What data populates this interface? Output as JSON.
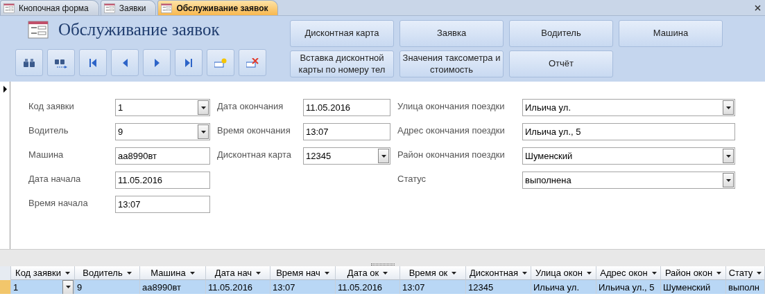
{
  "tabs": [
    {
      "label": "Кнопочная форма",
      "selected": false
    },
    {
      "label": "Заявки",
      "selected": false
    },
    {
      "label": "Обслуживание заявок",
      "selected": true
    }
  ],
  "title": "Обслуживание заявок",
  "nav_buttons": [
    {
      "kind": "find"
    },
    {
      "kind": "find-next"
    },
    {
      "kind": "first"
    },
    {
      "kind": "prev"
    },
    {
      "kind": "next"
    },
    {
      "kind": "last"
    },
    {
      "kind": "new"
    },
    {
      "kind": "delete"
    }
  ],
  "action_buttons": [
    [
      "Дисконтная карта",
      "Заявка",
      "Водитель",
      "Машина"
    ],
    [
      "Вставка дисконтной карты по номеру тел",
      "Значения таксометра и стоимость",
      "Отчёт"
    ]
  ],
  "fields": [
    [
      {
        "label": "Код заявки",
        "value": "1",
        "kind": "combo"
      },
      {
        "label": "Водитель",
        "value": "9",
        "kind": "combo"
      },
      {
        "label": "Машина",
        "value": "аа8990вт",
        "kind": "text"
      },
      {
        "label": "Дата начала",
        "value": "11.05.2016",
        "kind": "text"
      },
      {
        "label": "Время начала",
        "value": "13:07",
        "kind": "text"
      }
    ],
    [
      {
        "label": "Дата окончания",
        "value": "11.05.2016",
        "kind": "text"
      },
      {
        "label": "Время окончания",
        "value": "13:07",
        "kind": "text"
      },
      {
        "label": "Дисконтная карта",
        "value": "12345",
        "kind": "combo"
      }
    ],
    [
      {
        "label": "Улица окончания поездки",
        "value": "Ильича ул.",
        "kind": "combo"
      },
      {
        "label": "Адрес окончания поездки",
        "value": "Ильича ул., 5",
        "kind": "text"
      },
      {
        "label": "Район окончания поездки",
        "value": "Шуменский",
        "kind": "combo"
      },
      {
        "label": "Статус",
        "value": "выполнена",
        "kind": "combo"
      }
    ]
  ],
  "datasheet": {
    "columns": [
      "Код заявки",
      "Водитель",
      "Машина",
      "Дата нач",
      "Время нач",
      "Дата ок",
      "Время ок",
      "Дисконтная",
      "Улица окон",
      "Адрес окон",
      "Район окон",
      "Стату"
    ],
    "rows": [
      {
        "selected": true,
        "cells": [
          "1",
          "9",
          "аа8990вт",
          "11.05.2016",
          "13:07",
          "11.05.2016",
          "13:07",
          "12345",
          "Ильича ул.",
          "Ильича ул., 5",
          "Шуменский",
          "выполн"
        ]
      }
    ]
  }
}
